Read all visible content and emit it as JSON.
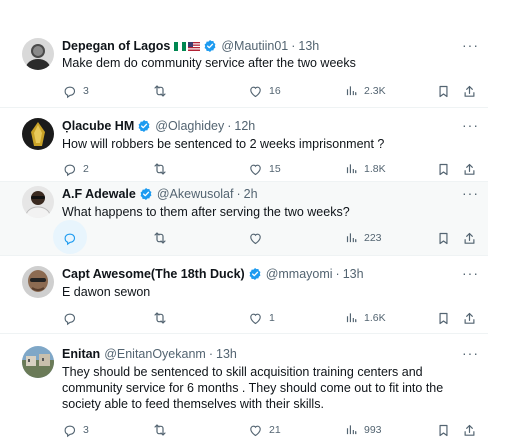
{
  "tweets": [
    {
      "name": "Depegan of Lagos",
      "handle": "@Mautiin01",
      "time": "13h",
      "text": "Make dem do community service after the two weeks",
      "counts": {
        "reply": "3",
        "retweet": "",
        "like": "16",
        "views": "2.3K"
      },
      "verified": true,
      "flags": true,
      "highlighted": false
    },
    {
      "name": "Ọlacube HM",
      "handle": "@Olaghidey",
      "time": "12h",
      "text": "How will robbers be sentenced to 2 weeks imprisonment ?",
      "counts": {
        "reply": "2",
        "retweet": "",
        "like": "15",
        "views": "1.8K"
      },
      "verified": true,
      "flags": false,
      "highlighted": false
    },
    {
      "name": "A.F Adewale",
      "handle": "@Akewusolaf",
      "time": "2h",
      "text": "What happens to them after serving the two weeks?",
      "counts": {
        "reply": "",
        "retweet": "",
        "like": "",
        "views": "223"
      },
      "verified": true,
      "flags": false,
      "highlighted": true
    },
    {
      "name": "Capt Awesome(The 18th Duck)",
      "handle": "@mmayomi",
      "time": "13h",
      "text": "E dawon sewon",
      "counts": {
        "reply": "",
        "retweet": "",
        "like": "1",
        "views": "1.6K"
      },
      "verified": true,
      "flags": false,
      "highlighted": false
    },
    {
      "name": "Enitan",
      "handle": "@EnitanOyekanm",
      "time": "13h",
      "text_lines": [
        "They should be sentenced to skill acquisition training centers and",
        "community service for 6 months . They should come out to fit into the",
        "society able to feed themselves with their skills."
      ],
      "counts": {
        "reply": "3",
        "retweet": "",
        "like": "21",
        "views": "993"
      },
      "verified": false,
      "flags": false,
      "highlighted": false
    }
  ],
  "separator": "·",
  "more_label": "···",
  "colors": {
    "text": "#0f1419",
    "muted": "#536471",
    "verified": "#1d9bf0",
    "border": "#eff3f4",
    "highlight": "#f7f9f9"
  },
  "icons": [
    "reply-icon",
    "retweet-icon",
    "like-icon",
    "views-icon",
    "bookmark-icon",
    "share-icon",
    "verified-icon",
    "more-icon"
  ]
}
